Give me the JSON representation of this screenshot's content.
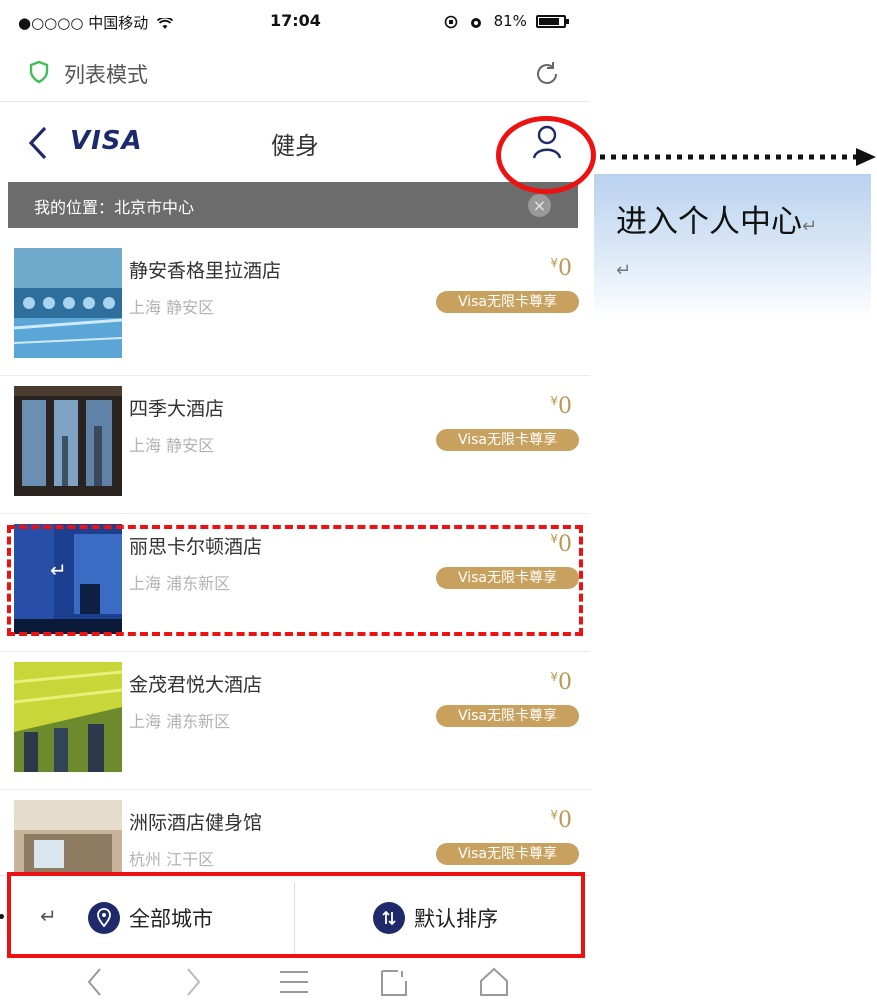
{
  "statusbar": {
    "carrier": "●○○○○ 中国移动",
    "time": "17:04",
    "battery": "81%"
  },
  "urlbar": {
    "mode_label": "列表模式"
  },
  "navbar": {
    "logo": "VISA",
    "title": "健身"
  },
  "location": {
    "text": "我的位置：北京市中心",
    "close_glyph": "×"
  },
  "currency_symbol": "¥",
  "return_mark": "↵",
  "items": [
    {
      "name": "静安香格里拉酒店",
      "area": "上海 静安区",
      "price": "0",
      "badge": "Visa无限卡尊享"
    },
    {
      "name": "四季大酒店",
      "area": "上海 静安区",
      "price": "0",
      "badge": "Visa无限卡尊享"
    },
    {
      "name": "丽思卡尔顿酒店",
      "area": "上海 浦东新区",
      "price": "0",
      "badge": "Visa无限卡尊享"
    },
    {
      "name": "金茂君悦大酒店",
      "area": "上海 浦东新区",
      "price": "0",
      "badge": "Visa无限卡尊享"
    },
    {
      "name": "洲际酒店健身馆",
      "area": "杭州 江干区",
      "price": "0",
      "badge": "Visa无限卡尊享"
    }
  ],
  "bottombar": {
    "city_label": "全部城市",
    "sort_label": "默认排序"
  },
  "annotation": {
    "callout_text": "进入个人中心",
    "accent_color": "#ee1111"
  },
  "colors": {
    "brand_navy": "#1f2a6b",
    "gold": "#c9a15f",
    "location_bar": "#6c6c6c"
  }
}
